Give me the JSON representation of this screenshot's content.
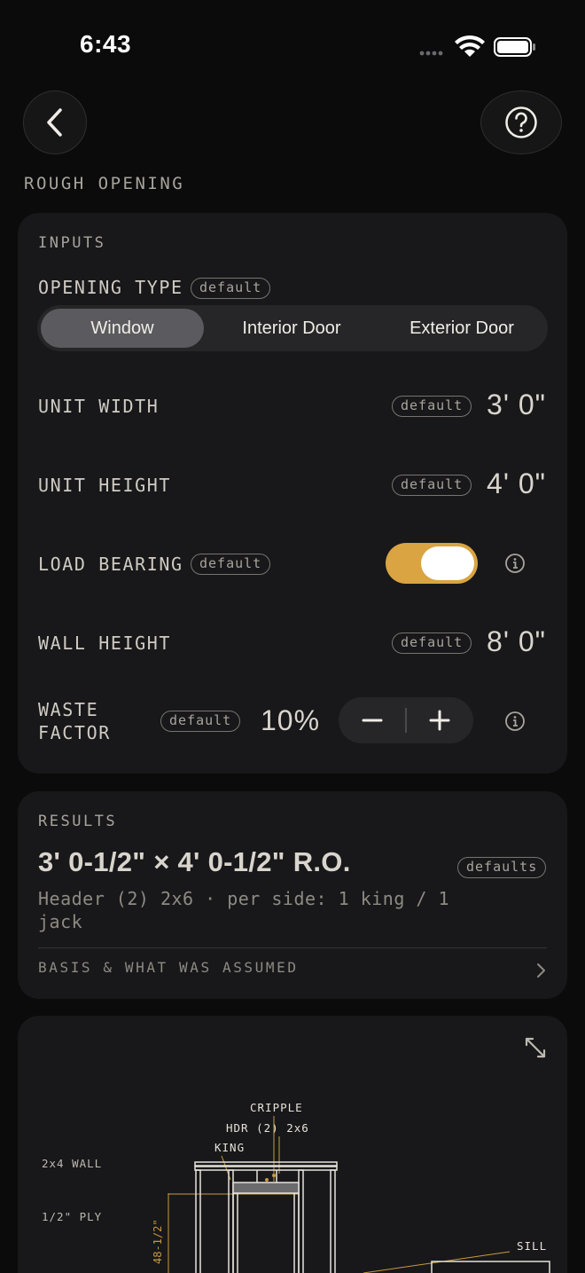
{
  "status_bar": {
    "time": "6:43"
  },
  "header": {
    "title": "ROUGH OPENING"
  },
  "inputs": {
    "section_label": "INPUTS",
    "opening_type": {
      "label": "OPENING TYPE",
      "badge": "default",
      "options": [
        "Window",
        "Interior Door",
        "Exterior Door"
      ],
      "selected": "Window"
    },
    "unit_width": {
      "label": "UNIT WIDTH",
      "badge": "default",
      "value": "3' 0\""
    },
    "unit_height": {
      "label": "UNIT HEIGHT",
      "badge": "default",
      "value": "4' 0\""
    },
    "load_bearing": {
      "label": "LOAD BEARING",
      "badge": "default",
      "on": true
    },
    "wall_height": {
      "label": "WALL HEIGHT",
      "badge": "default",
      "value": "8' 0\""
    },
    "waste_factor": {
      "label_line1": "WASTE",
      "label_line2": "FACTOR",
      "badge": "default",
      "value": "10%",
      "decrement": "−",
      "increment": "+"
    }
  },
  "results": {
    "section_label": "RESULTS",
    "main": "3' 0-1/2\" × 4' 0-1/2\" R.O.",
    "badge": "defaults",
    "detail": "Header (2) 2x6  ·  per side: 1 king / 1 jack",
    "basis_link": "BASIS & WHAT WAS ASSUMED"
  },
  "diagram": {
    "labels": {
      "cripple": "CRIPPLE",
      "header": "HDR (2) 2x6",
      "king": "KING",
      "wall": "2x4 WALL",
      "ply": "1/2\" PLY",
      "sill": "SILL",
      "dimension": "48-1/2\""
    }
  },
  "colors": {
    "accent": "#d9a441",
    "background": "#0b0b0c",
    "card": "#18181a",
    "control": "#262628"
  }
}
